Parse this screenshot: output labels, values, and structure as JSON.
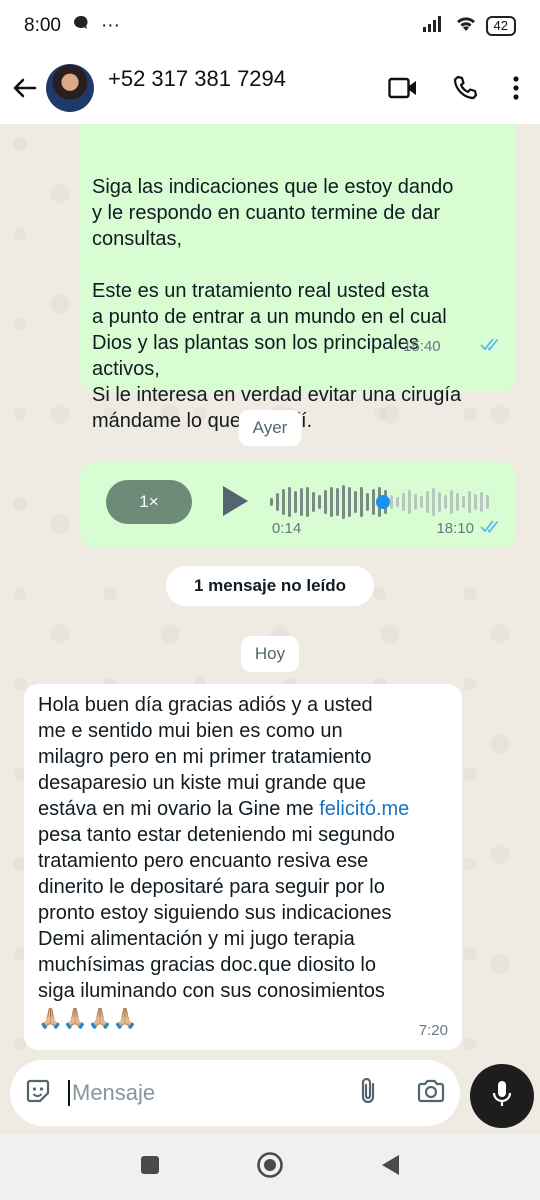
{
  "status_bar": {
    "time": "8:00",
    "dots": "···",
    "battery": "42"
  },
  "header": {
    "contact": "+52 317 381 7294"
  },
  "messages": {
    "msg1": {
      "text": "Siga las indicaciones que le estoy dando\ny le respondo en cuanto termine de dar\nconsultas,\n\nEste es un tratamiento real usted esta\na punto de entrar a un mundo en el cual\nDios y las plantas son los principales\nactivos,\nSi le interesa en verdad evitar una cirugía\nmándame lo que le pedí.",
      "time": "15:40"
    },
    "divider_yesterday": "Ayer",
    "voice": {
      "speed": "1×",
      "duration": "0:14",
      "time": "18:10"
    },
    "unread": "1 mensaje no leído",
    "divider_today": "Hoy",
    "msg3": {
      "text_before": "Hola buen día gracias adiós y a usted\nme e sentido mui bien es como un\nmilagro pero en mi primer tratamiento\ndesaparesio un kiste mui grande que\nestáva en mi ovario la Gine me ",
      "link": "felicitó.me",
      "text_after": "\npesa tanto estar deteniendo mi segundo\ntratamiento pero encuanto resiva ese\ndinerito le depositaré para seguir por lo\npronto estoy siguiendo sus indicaciones\nDemi alimentación y mi jugo terapia\nmuchísimas gracias doc.que diosito lo\nsiga iluminando con sus conosimientos",
      "emoji": "🙏🏼🙏🏼🙏🏼🙏🏼",
      "time": "7:20"
    }
  },
  "input": {
    "placeholder": "Mensaje"
  },
  "colors": {
    "outgoing_bubble": "#d9fdd3",
    "incoming_bubble": "#ffffff",
    "chat_background": "#efeae2",
    "read_tick": "#53bdeb",
    "link": "#1b72c4"
  }
}
